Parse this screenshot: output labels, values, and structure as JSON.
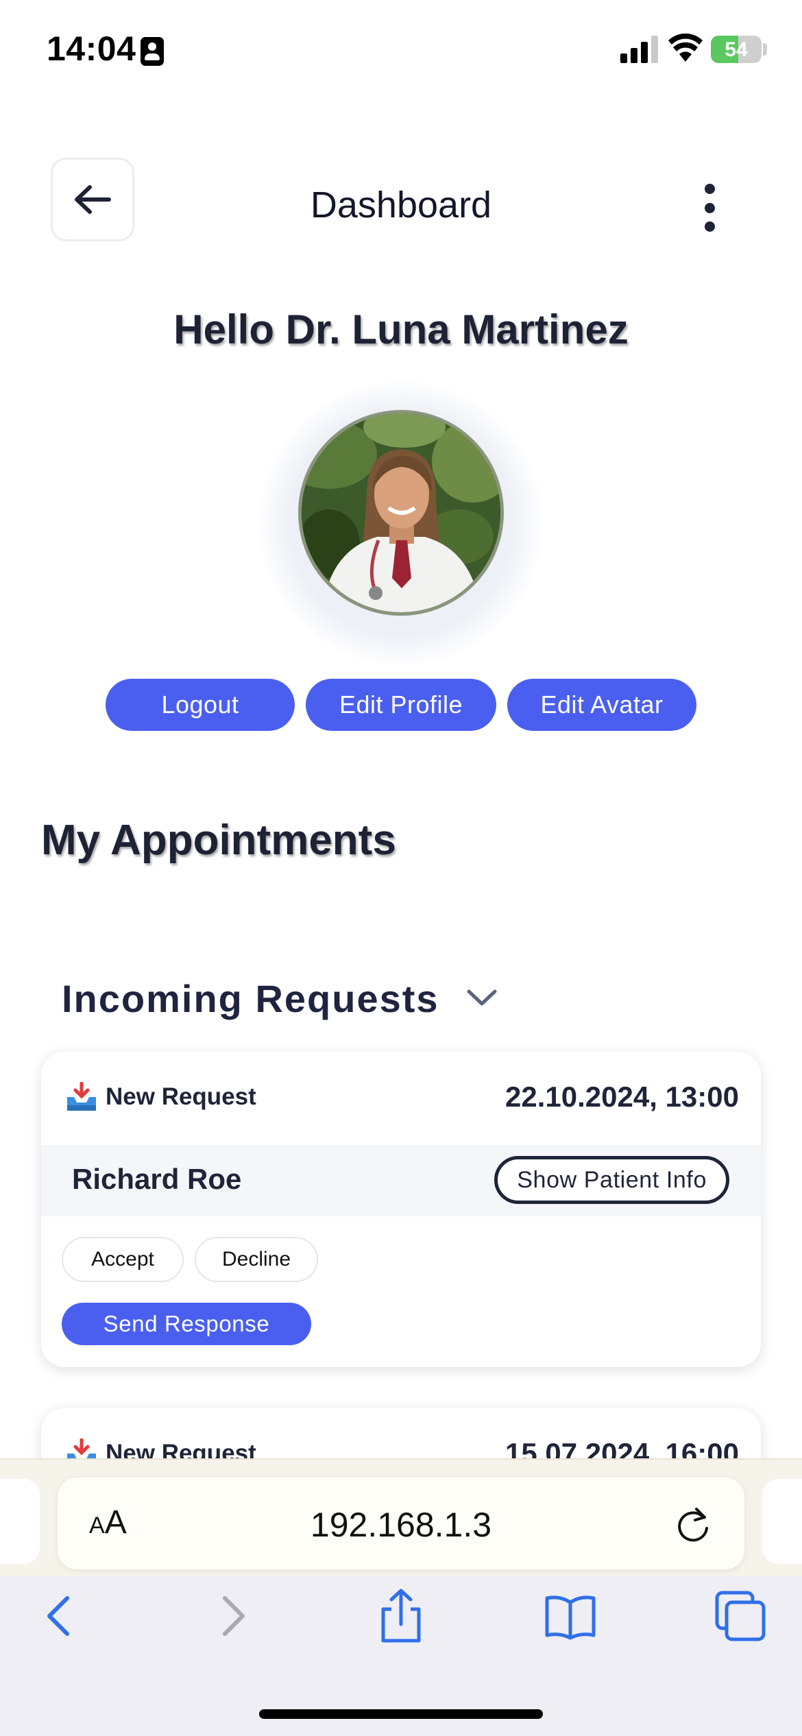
{
  "status_bar": {
    "time": "14:04",
    "battery_percent": "54",
    "battery_level": 0.54,
    "icons": [
      "person-badge-icon",
      "cellular-signal-icon",
      "wifi-icon",
      "battery-charging-icon"
    ]
  },
  "header": {
    "title": "Dashboard",
    "back_icon": "arrow-left-icon",
    "menu_icon": "more-vertical-icon"
  },
  "greeting": "Hello Dr. Luna Martinez",
  "profile_actions": {
    "logout_label": "Logout",
    "edit_profile_label": "Edit Profile",
    "edit_avatar_label": "Edit Avatar"
  },
  "appointments": {
    "title": "My Appointments",
    "incoming": {
      "title": "Incoming Requests",
      "toggle_icon": "chevron-down-icon",
      "requests": [
        {
          "icon": "inbox-tray-icon",
          "label": "New Request",
          "datetime": "22.10.2024, 13:00",
          "patient": "Richard Roe",
          "info_label": "Show Patient Info",
          "accept_label": "Accept",
          "decline_label": "Decline",
          "send_label": "Send Response"
        },
        {
          "icon": "inbox-tray-icon",
          "label": "New Request",
          "datetime": "15.07.2024, 16:00"
        }
      ]
    }
  },
  "browser": {
    "text_size_label_small": "A",
    "text_size_label_large": "A",
    "url": "192.168.1.3",
    "icons": [
      "reload-icon",
      "back-icon",
      "forward-icon",
      "share-icon",
      "bookmarks-icon",
      "tabs-icon"
    ]
  },
  "colors": {
    "accent": "#4a5ff0",
    "text_dark": "#1f2438",
    "battery_green": "#5ac85f"
  }
}
